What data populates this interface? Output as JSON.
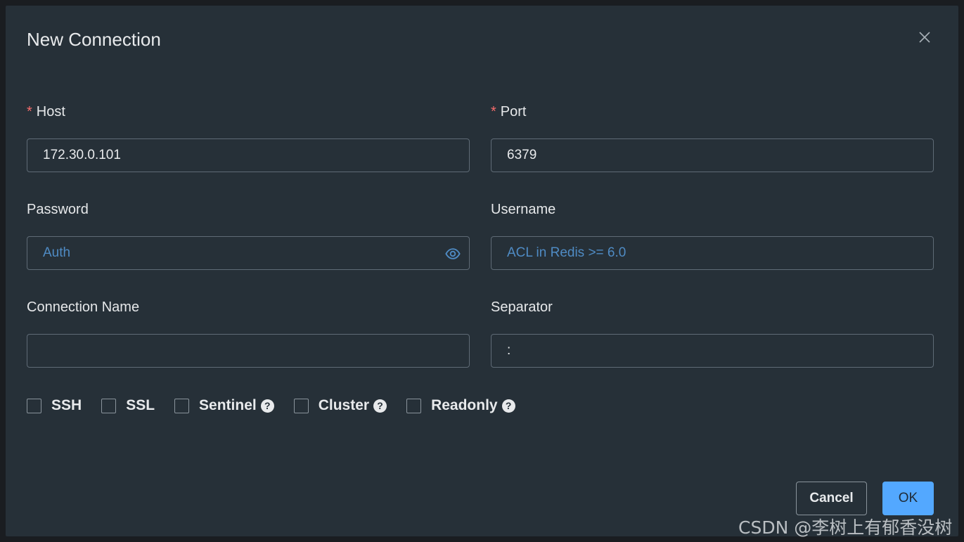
{
  "dialog": {
    "title": "New Connection"
  },
  "fields": {
    "host": {
      "label": "Host",
      "value": "172.30.0.101",
      "placeholder": ""
    },
    "port": {
      "label": "Port",
      "value": "6379",
      "placeholder": ""
    },
    "password": {
      "label": "Password",
      "value": "",
      "placeholder": "Auth"
    },
    "username": {
      "label": "Username",
      "value": "",
      "placeholder": "ACL in Redis >= 6.0"
    },
    "connection_name": {
      "label": "Connection Name",
      "value": "",
      "placeholder": ""
    },
    "separator": {
      "label": "Separator",
      "value": ":",
      "placeholder": ""
    }
  },
  "required_mark": "*",
  "options": {
    "ssh": "SSH",
    "ssl": "SSL",
    "sentinel": "Sentinel",
    "cluster": "Cluster",
    "readonly": "Readonly"
  },
  "help_glyph": "?",
  "buttons": {
    "cancel": "Cancel",
    "ok": "OK"
  },
  "watermark": "CSDN @李树上有郁香没树",
  "icons": {
    "close": "close-icon",
    "eye": "eye-icon",
    "help": "question-circle-icon"
  },
  "colors": {
    "background": "#263038",
    "required": "#f56c6c",
    "primary": "#53a8ff",
    "placeholder": "#4f8bc4"
  }
}
